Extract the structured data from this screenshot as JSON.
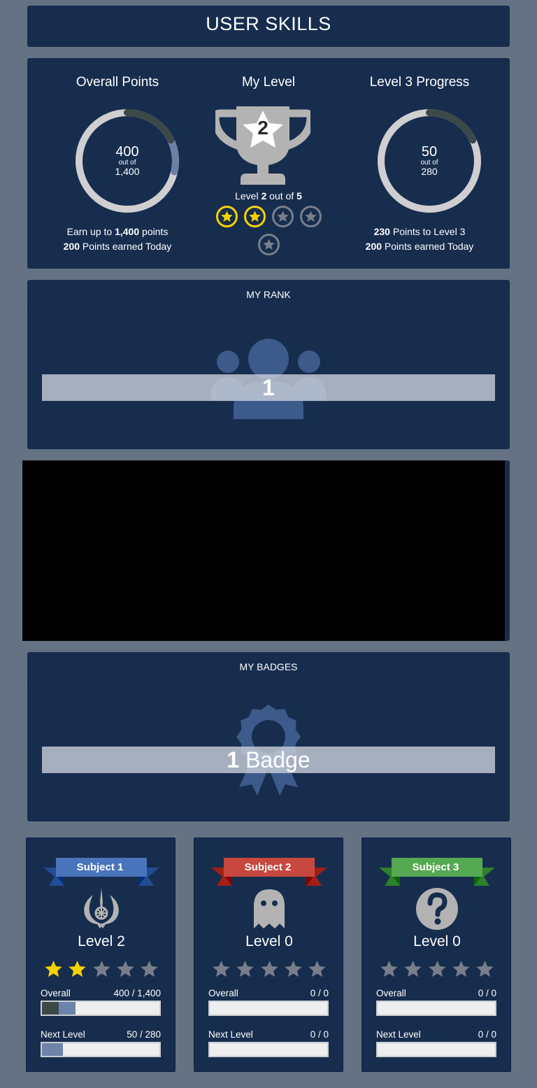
{
  "header": {
    "title": "USER SKILLS"
  },
  "summary": {
    "overall": {
      "title": "Overall Points",
      "value": "400",
      "out_of_label": "out of",
      "total": "1,400",
      "earn_prefix": "Earn up to",
      "earn_value": "1,400",
      "earn_suffix": "points",
      "today_value": "200",
      "today_suffix": "Points earned Today",
      "progress_fraction": 0.2857
    },
    "level": {
      "title": "My Level",
      "number": "2",
      "level_prefix": "Level",
      "current": "2",
      "out_of": "out of",
      "max": "5",
      "stars_earned": 2,
      "stars_total": 5
    },
    "progress": {
      "title": "Level 3 Progress",
      "value": "50",
      "out_of_label": "out of",
      "total": "280",
      "to_level_value": "230",
      "to_level_suffix": "Points to Level 3",
      "today_value": "200",
      "today_suffix": "Points earned Today",
      "progress_fraction": 0.1786
    }
  },
  "rank": {
    "title": "MY RANK",
    "value": "1"
  },
  "badges": {
    "title": "MY BADGES",
    "count": "1",
    "label": "Badge"
  },
  "subjects": [
    {
      "name": "Subject 1",
      "color": "#4a74bb",
      "level": "Level 2",
      "stars": 2,
      "overall_label": "Overall",
      "overall_value": "400 / 1,400",
      "overall_fraction": 0.2857,
      "next_label": "Next Level",
      "next_value": "50 / 280",
      "next_fraction": 0.1786,
      "icon": "jedi-icon"
    },
    {
      "name": "Subject 2",
      "color": "#c8473e",
      "level": "Level 0",
      "stars": 0,
      "overall_label": "Overall",
      "overall_value": "0 / 0",
      "overall_fraction": 0,
      "next_label": "Next Level",
      "next_value": "0 / 0",
      "next_fraction": 0,
      "icon": "ghost-icon"
    },
    {
      "name": "Subject 3",
      "color": "#55a952",
      "level": "Level 0",
      "stars": 0,
      "overall_label": "Overall",
      "overall_value": "0 / 0",
      "overall_fraction": 0,
      "next_label": "Next Level",
      "next_value": "0 / 0",
      "next_fraction": 0,
      "icon": "question-icon"
    }
  ],
  "colors": {
    "panel": "#172d4e",
    "background": "#647283",
    "star_on": "#f5d300",
    "star_off": "#797e8b"
  }
}
